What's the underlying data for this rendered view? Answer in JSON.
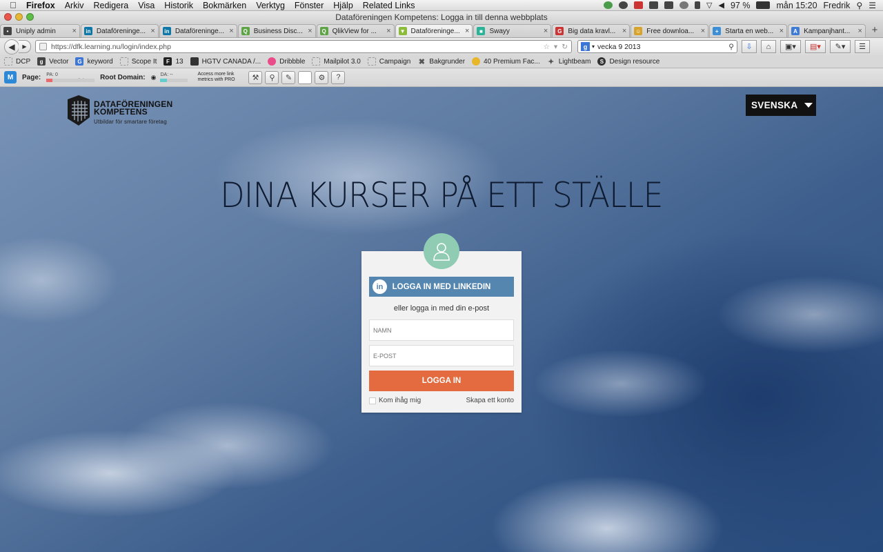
{
  "menubar": {
    "app": "Firefox",
    "items": [
      "Arkiv",
      "Redigera",
      "Visa",
      "Historik",
      "Bokmärken",
      "Verktyg",
      "Fönster",
      "Hjälp",
      "Related Links"
    ],
    "battery": "97 %",
    "clock": "mån 15:20",
    "user": "Fredrik"
  },
  "window": {
    "title": "Dataföreningen Kompetens: Logga in till denna webbplats"
  },
  "tabs": [
    {
      "label": "Uniply admin",
      "icon_color": "#444"
    },
    {
      "label": "Dataföreninge...",
      "icon_color": "#0e76a8"
    },
    {
      "label": "Dataföreninge...",
      "icon_color": "#0e76a8"
    },
    {
      "label": "Business Disc...",
      "icon_color": "#5ea447"
    },
    {
      "label": "QlikView for ...",
      "icon_color": "#5ea447"
    },
    {
      "label": "Dataföreninge...",
      "icon_color": "#8dbb3c",
      "active": true
    },
    {
      "label": "Swayy",
      "icon_color": "#2bb39a"
    },
    {
      "label": "Big data kravl...",
      "icon_color": "#c33"
    },
    {
      "label": "Free downloa...",
      "icon_color": "#d8a32a"
    },
    {
      "label": "Starta en web...",
      "icon_color": "#3c8fd6"
    },
    {
      "label": "Kampanjhant...",
      "icon_color": "#3d7bd6"
    }
  ],
  "navbar": {
    "url": "https://dfk.learning.nu/login/index.php",
    "search": "vecka 9 2013"
  },
  "bookmarks": [
    {
      "label": "DCP",
      "color": "#bbb"
    },
    {
      "label": "Vector",
      "color": "#444"
    },
    {
      "label": "keyword",
      "color": "#3c76d6"
    },
    {
      "label": "Scope It",
      "color": "#bbb"
    },
    {
      "label": "13",
      "color": "#222"
    },
    {
      "label": "HGTV CANADA /...",
      "color": "#333"
    },
    {
      "label": "Dribbble",
      "color": "#ea4c89"
    },
    {
      "label": "Mailpilot 3.0",
      "color": "#bbb"
    },
    {
      "label": "Campaign",
      "color": "#bbb"
    },
    {
      "label": "Bakgrunder",
      "color": "#555"
    },
    {
      "label": "40 Premium Fac...",
      "color": "#e8b62a"
    },
    {
      "label": "Lightbeam",
      "color": "#555"
    },
    {
      "label": "Design resource",
      "color": "#333"
    }
  ],
  "mozbar": {
    "page_label": "Page:",
    "pa": "PA: 0",
    "pa_fill": 0.12,
    "links": "0 links",
    "root_label": "Root Domain:",
    "da": "DA: --",
    "da_fill": 0.25,
    "promo": "Access more link metrics with PRO"
  },
  "page": {
    "logo": {
      "name_line1": "DATAFÖRENINGEN",
      "name_line2": "KOMPETENS",
      "tagline": "Utbildar för smartare företag"
    },
    "language": "SVENSKA",
    "headline": "DINA KURSER PÅ ETT STÄLLE",
    "login": {
      "linkedin_label": "LOGGA IN MED LINKEDIN",
      "or_label": "eller logga in med din e-post",
      "name_placeholder": "NAMN",
      "email_placeholder": "E-POST",
      "submit_label": "LOGGA IN",
      "remember_label": "Kom ihåg mig",
      "create_label": "Skapa ett konto"
    }
  },
  "colors": {
    "linkedin": "#5586b0",
    "login_button": "#e36b3f",
    "avatar": "#8fccb3"
  }
}
